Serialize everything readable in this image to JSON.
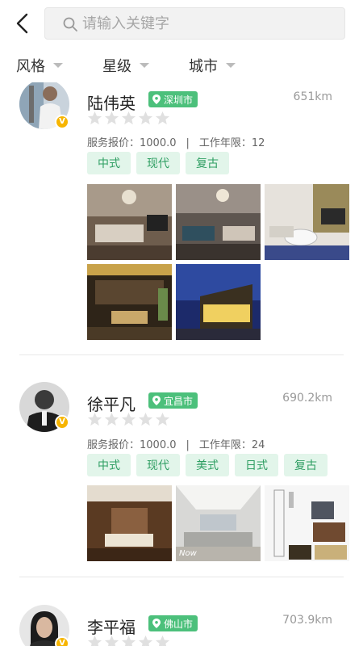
{
  "header": {
    "search_placeholder": "请输入关键字"
  },
  "filters": [
    {
      "label": "风格"
    },
    {
      "label": "星级"
    },
    {
      "label": "城市"
    }
  ],
  "designers": [
    {
      "name": "陆伟英",
      "city": "深圳市",
      "distance": "651km",
      "rating_stars": 0,
      "max_stars": 5,
      "price_label": "服务报价：1000.0",
      "separator": "|",
      "years_label": "工作年限：12",
      "badge": "V",
      "tags": [
        "中式",
        "现代",
        "复古"
      ],
      "photo_count": 5
    },
    {
      "name": "徐平凡",
      "city": "宜昌市",
      "distance": "690.2km",
      "rating_stars": 0,
      "max_stars": 5,
      "price_label": "服务报价：1000.0",
      "separator": "|",
      "years_label": "工作年限：24",
      "badge": "V",
      "tags": [
        "中式",
        "现代",
        "美式",
        "日式",
        "复古"
      ],
      "photo_count": 3,
      "photo_caption": "Now"
    },
    {
      "name": "李平福",
      "city": "佛山市",
      "distance": "703.9km",
      "rating_stars": 0,
      "max_stars": 5,
      "badge": "V"
    }
  ],
  "colors": {
    "accent_green": "#4cc07b",
    "tag_bg": "#e2f5ea",
    "tag_text": "#2e9e62",
    "badge_gold": "#f7b500",
    "star_empty": "#e0e0e0"
  }
}
